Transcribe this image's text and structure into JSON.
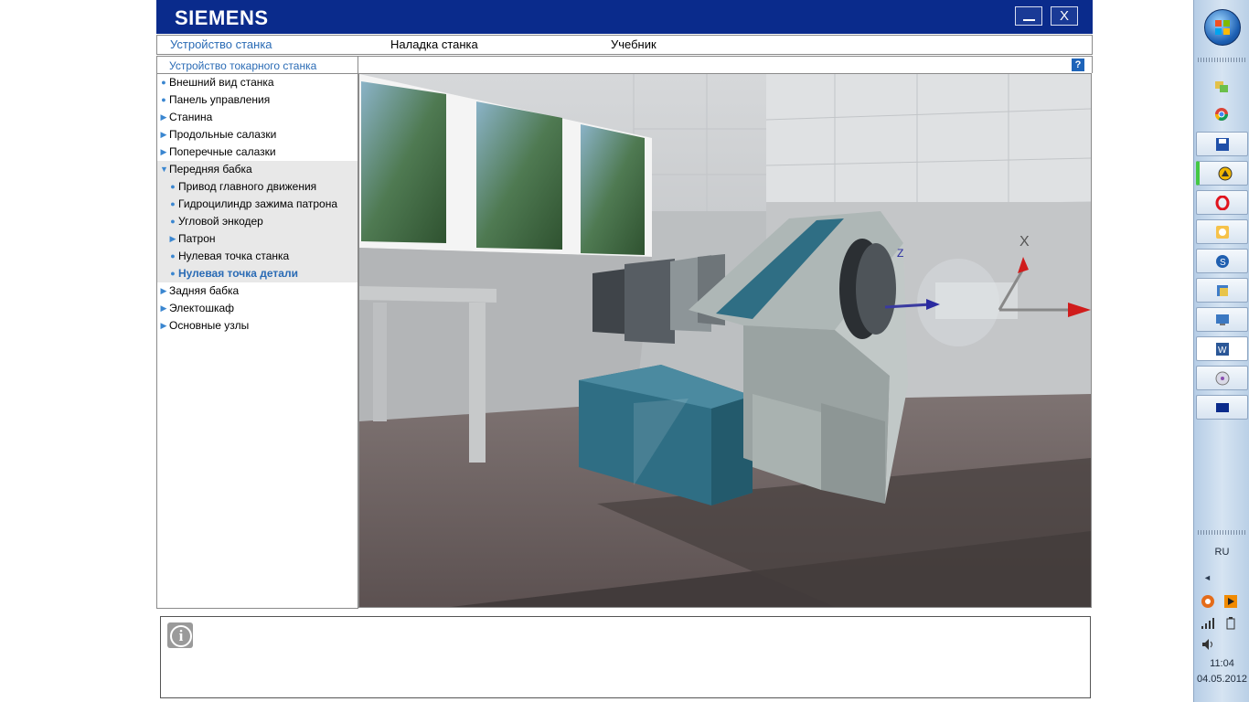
{
  "app": {
    "logo": "SIEMENS",
    "minimize_label": "_",
    "close_label": "X"
  },
  "tabs": [
    {
      "label": "Устройство станка",
      "active": true
    },
    {
      "label": "Наладка станка",
      "active": false
    },
    {
      "label": "Учебник",
      "active": false
    }
  ],
  "sidebar": {
    "header": "Устройство токарного станка",
    "items": [
      {
        "label": "Внешний вид станка",
        "marker": "dot"
      },
      {
        "label": "Панель управления",
        "marker": "dot"
      },
      {
        "label": "Станина",
        "marker": "arrow"
      },
      {
        "label": "Продольные салазки",
        "marker": "arrow"
      },
      {
        "label": "Поперечные салазки",
        "marker": "arrow"
      },
      {
        "label": "Передняя бабка",
        "marker": "open"
      },
      {
        "label": "Привод главного движения",
        "marker": "dot"
      },
      {
        "label": "Гидроцилиндр зажима патрона",
        "marker": "dot"
      },
      {
        "label": "Угловой энкодер",
        "marker": "dot"
      },
      {
        "label": "Патрон",
        "marker": "arrow"
      },
      {
        "label": "Нулевая точка станка",
        "marker": "dot"
      },
      {
        "label": "Нулевая точка детали",
        "marker": "dot"
      },
      {
        "label": "Задняя бабка",
        "marker": "arrow"
      },
      {
        "label": "Электошкаф",
        "marker": "arrow"
      },
      {
        "label": "Основные узлы",
        "marker": "arrow"
      }
    ]
  },
  "viewer": {
    "help_label": "?",
    "axis_z_label": "Z",
    "axis_x_label": "X"
  },
  "info": {
    "icon": "info-icon",
    "text": ""
  },
  "taskbar": {
    "language": "RU",
    "time": "11:04",
    "date": "04.05.2012",
    "pinned": [
      "shared-folders-icon",
      "chrome-icon",
      "save-icon",
      "warning-app-icon",
      "opera-icon",
      "clock-app-icon",
      "skype-icon",
      "library-icon",
      "remote-desktop-icon",
      "word-icon",
      "media-disc-icon",
      "siemens-app-icon"
    ]
  },
  "colors": {
    "brand_blue": "#0a2b8c",
    "link_blue": "#2a6bb5",
    "machine_teal": "#2f6e84"
  }
}
